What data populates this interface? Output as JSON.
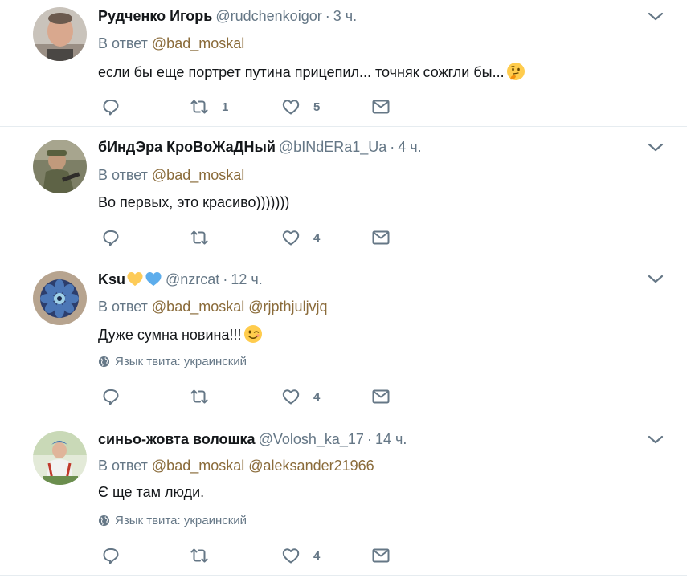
{
  "tweets": [
    {
      "name": "Рудченко Игорь",
      "name_emoji": [],
      "handle": "@rudchenkoigor",
      "time": "3 ч.",
      "reply_prefix": "В ответ",
      "reply_mentions": [
        "@bad_moskal"
      ],
      "text": "если бы еще портрет путина прицепил... точняк сожгли бы...",
      "text_emoji": "thinking-face",
      "language_note": "",
      "retweets": "1",
      "likes": "5"
    },
    {
      "name": "бИндЭра КроВоЖаДНый",
      "name_emoji": [],
      "handle": "@bINdERa1_Ua",
      "time": "4 ч.",
      "reply_prefix": "В ответ",
      "reply_mentions": [
        "@bad_moskal"
      ],
      "text": "Во первых, это красиво)))))))",
      "text_emoji": "",
      "language_note": "",
      "retweets": "",
      "likes": "4"
    },
    {
      "name": "Ksu",
      "name_emoji": [
        "yellow-heart",
        "blue-heart"
      ],
      "handle": "@nzrcat",
      "time": "12 ч.",
      "reply_prefix": "В ответ",
      "reply_mentions": [
        "@bad_moskal",
        "@rjpthjuljvjq"
      ],
      "text": "Дуже сумна новина!!!",
      "text_emoji": "winking-face",
      "language_note": "Язык твита: украинский",
      "retweets": "",
      "likes": "4"
    },
    {
      "name": "синьо-жовта волошка",
      "name_emoji": [],
      "handle": "@Volosh_ka_17",
      "time": "14 ч.",
      "reply_prefix": "В ответ",
      "reply_mentions": [
        "@bad_moskal",
        "@aleksander21966"
      ],
      "text": "Є ще там люди.",
      "text_emoji": "",
      "language_note": "Язык твита: украинский",
      "retweets": "",
      "likes": "4"
    }
  ],
  "colors": {
    "name": "#14171a",
    "meta": "#657786",
    "mention": "#8a6b3a",
    "divider": "#e6ecf0",
    "icon": "#657786"
  },
  "icons": {
    "reply": "reply-icon",
    "retweet": "retweet-icon",
    "like": "like-heart-icon",
    "dm": "direct-message-icon",
    "caret": "chevron-down-icon",
    "globe": "globe-icon"
  }
}
